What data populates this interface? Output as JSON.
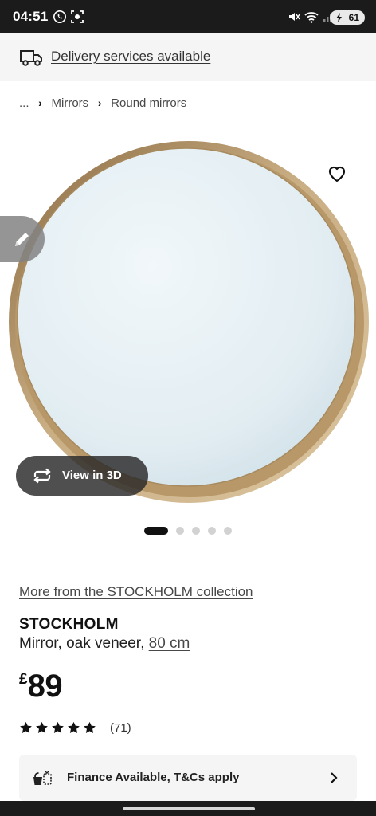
{
  "status_bar": {
    "time": "04:51",
    "battery": "61",
    "icons": [
      "whatsapp-icon",
      "screen-record-icon",
      "mute-icon",
      "wifi-icon",
      "signal-icon",
      "battery-icon"
    ]
  },
  "delivery": {
    "label": "Delivery services available",
    "icon": "truck-icon"
  },
  "breadcrumb": {
    "ellipsis": "...",
    "items": [
      "Mirrors",
      "Round mirrors"
    ]
  },
  "image": {
    "view3d_label": "View in 3D",
    "favourite_icon": "heart-icon",
    "edit_icon": "pencil-icon",
    "slides": 5,
    "active_slide": 1
  },
  "product": {
    "collection_link": "More from the STOCKHOLM collection",
    "name": "STOCKHOLM",
    "description": "Mirror, oak veneer,",
    "size": "80 cm",
    "currency": "£",
    "price": "89",
    "rating": 5,
    "review_count": "(71)"
  },
  "finance": {
    "label": "Finance Available, T&Cs apply",
    "icon": "finance-icon"
  },
  "colors": {
    "status_bar": "#1b1b1b",
    "banner": "#f5f5f5",
    "mirror_frame": "#c4a77c",
    "mirror_glass": "#e2edf2"
  }
}
